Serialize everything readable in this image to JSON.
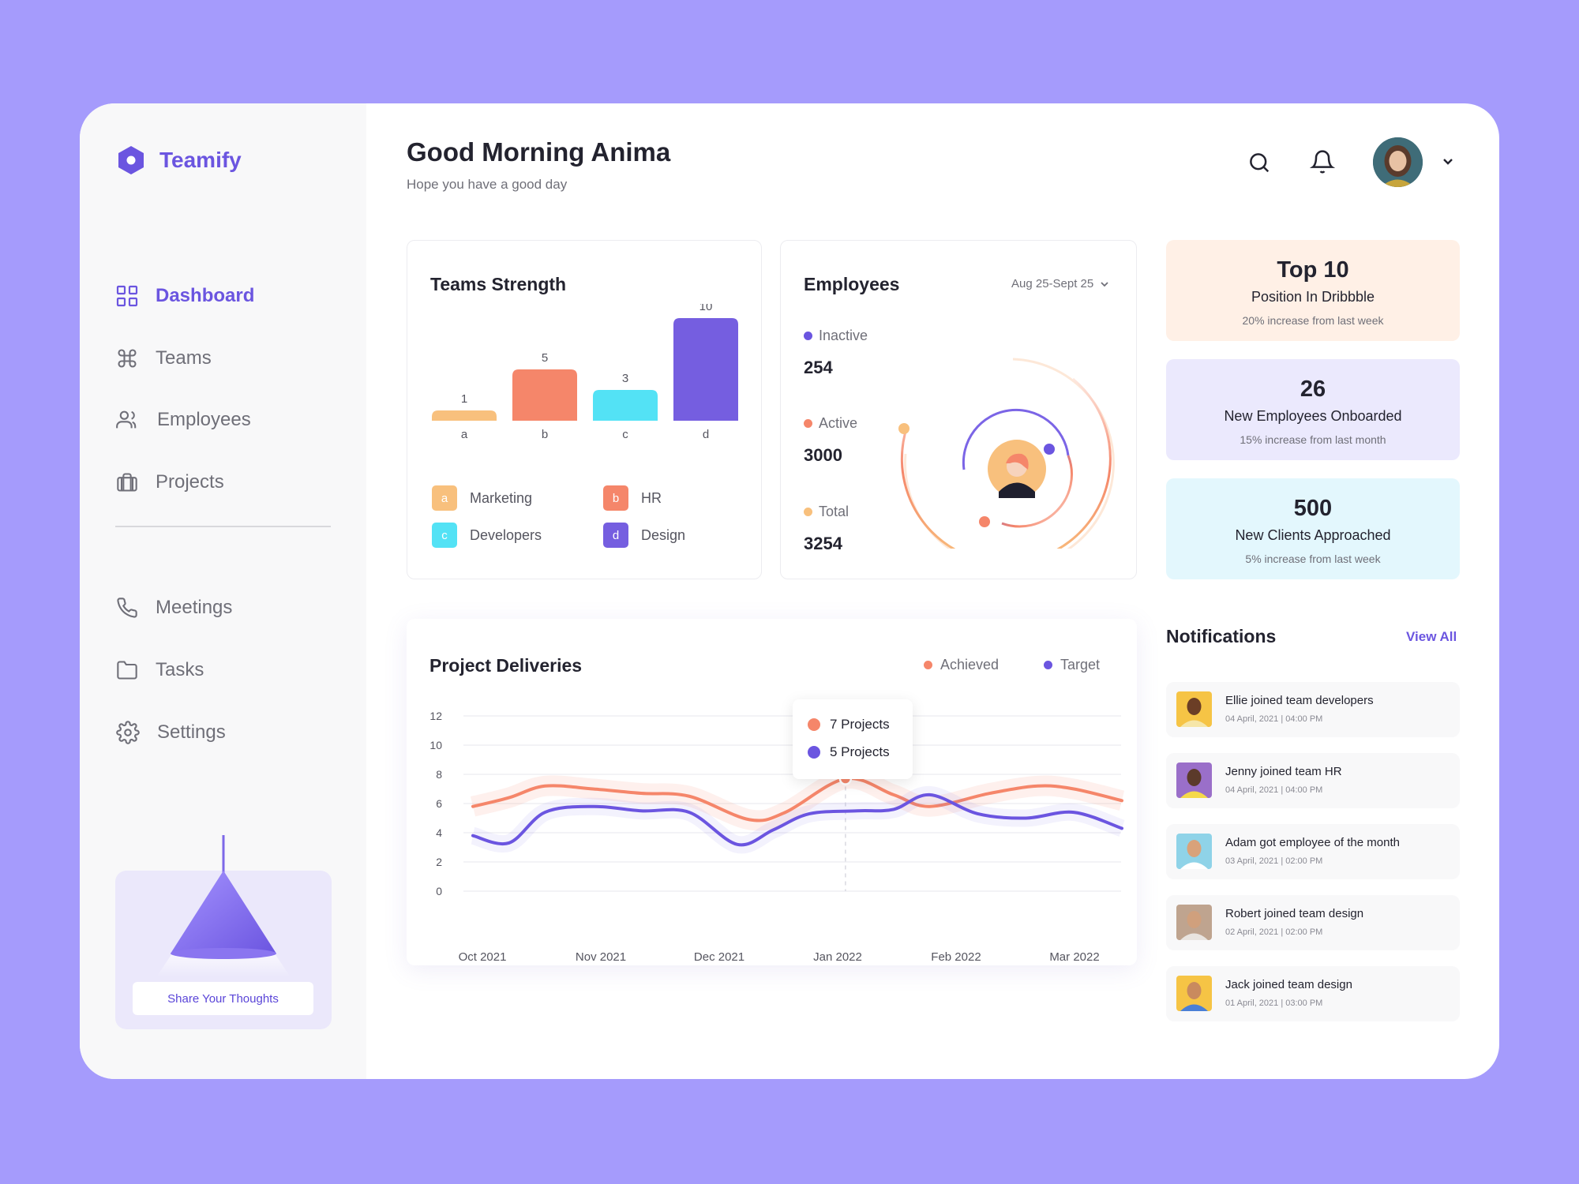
{
  "brand": {
    "name": "Teamify",
    "accent": "#6b55e0"
  },
  "nav_primary": [
    {
      "label": "Dashboard",
      "icon": "grid-icon",
      "active": true
    },
    {
      "label": "Teams",
      "icon": "command-icon"
    },
    {
      "label": "Employees",
      "icon": "users-icon"
    },
    {
      "label": "Projects",
      "icon": "briefcase-icon"
    }
  ],
  "nav_secondary": [
    {
      "label": "Meetings",
      "icon": "phone-icon"
    },
    {
      "label": "Tasks",
      "icon": "folder-icon"
    },
    {
      "label": "Settings",
      "icon": "gear-icon"
    }
  ],
  "promo": {
    "button_label": "Share Your Thoughts"
  },
  "header": {
    "title": "Good Morning Anima",
    "subtitle": "Hope you have a good day"
  },
  "teams_strength": {
    "title": "Teams Strength",
    "legend": [
      {
        "key": "a",
        "label": "Marketing",
        "color": "#f8c07d"
      },
      {
        "key": "b",
        "label": "HR",
        "color": "#f5866a"
      },
      {
        "key": "c",
        "label": "Developers",
        "color": "#53e2f5"
      },
      {
        "key": "d",
        "label": "Design",
        "color": "#755ee0"
      }
    ]
  },
  "employees": {
    "title": "Employees",
    "date_range": "Aug 25-Sept 25",
    "inactive": {
      "label": "Inactive",
      "value": "254",
      "color": "#6b55e0"
    },
    "active": {
      "label": "Active",
      "value": "3000",
      "color": "#f5866a"
    },
    "total": {
      "label": "Total",
      "value": "3254",
      "color": "#f8c07d"
    }
  },
  "stats": [
    {
      "value": "Top 10",
      "title": "Position In Dribbble",
      "sub": "20% increase from last week",
      "bg": "#fff0e6"
    },
    {
      "value": "26",
      "title": "New Employees Onboarded",
      "sub": "15% increase from last month",
      "bg": "#ebe9fd"
    },
    {
      "value": "500",
      "title": "New Clients Approached",
      "sub": "5% increase from last week",
      "bg": "#e3f7fd"
    }
  ],
  "project_deliveries": {
    "title": "Project Deliveries",
    "tooltip": {
      "achieved": "7 Projects",
      "target": "5 Projects"
    }
  },
  "notifications": {
    "title": "Notifications",
    "view_all": "View All",
    "items": [
      {
        "text": "Ellie joined team developers",
        "time": "04 April, 2021 | 04:00 PM",
        "bg": "#f6c445",
        "skin": "#6b3e26",
        "shirt": "#f6e6a8"
      },
      {
        "text": "Jenny joined team HR",
        "time": "04 April, 2021 | 04:00 PM",
        "bg": "#9a6fc9",
        "skin": "#5b3a2a",
        "shirt": "#f5d94a"
      },
      {
        "text": "Adam got employee of the month",
        "time": "03 April, 2021 | 02:00 PM",
        "bg": "#8fd3e8",
        "skin": "#d9a27a",
        "shirt": "#ffffff"
      },
      {
        "text": "Robert joined team design",
        "time": "02 April, 2021 | 02:00 PM",
        "bg": "#bfa48f",
        "skin": "#d0a07d",
        "shirt": "#e9e4df"
      },
      {
        "text": "Jack joined team design",
        "time": "01 April, 2021 | 03:00 PM",
        "bg": "#f6c445",
        "skin": "#c98a5e",
        "shirt": "#4a7fd6"
      }
    ]
  },
  "chart_data": [
    {
      "type": "bar",
      "title": "Teams Strength",
      "categories": [
        "a",
        "b",
        "c",
        "d"
      ],
      "values": [
        1,
        5,
        3,
        10
      ],
      "colors": [
        "#f8c07d",
        "#f5866a",
        "#53e2f5",
        "#755ee0"
      ],
      "ylim": [
        0,
        10
      ]
    },
    {
      "type": "line",
      "title": "Project Deliveries",
      "x_ticks": [
        "Oct 2021",
        "Nov 2021",
        "Dec 2021",
        "Jan 2022",
        "Feb 2022",
        "Mar 2022"
      ],
      "y_ticks": [
        0,
        2,
        4,
        6,
        8,
        10,
        12
      ],
      "ylim": [
        0,
        12
      ],
      "xlim": [
        -0.1,
        5.3
      ],
      "grid": true,
      "legend_position": "top-right",
      "series": [
        {
          "name": "Achieved",
          "color": "#f5866a",
          "x": [
            -0.1,
            0.2,
            0.5,
            0.9,
            1.3,
            1.7,
            2.2,
            2.5,
            3.0,
            3.4,
            3.7,
            4.2,
            4.6,
            4.9,
            5.3
          ],
          "y": [
            5.8,
            6.4,
            7.2,
            7.0,
            6.7,
            6.5,
            4.9,
            5.4,
            7.7,
            6.6,
            5.8,
            6.7,
            7.2,
            7.0,
            6.2
          ]
        },
        {
          "name": "Target",
          "color": "#6b55e0",
          "x": [
            -0.1,
            0.2,
            0.5,
            0.9,
            1.3,
            1.7,
            2.1,
            2.4,
            2.7,
            3.1,
            3.4,
            3.7,
            4.1,
            4.5,
            4.9,
            5.3
          ],
          "y": [
            3.8,
            3.3,
            5.4,
            5.8,
            5.5,
            5.4,
            3.2,
            4.2,
            5.3,
            5.5,
            5.6,
            6.6,
            5.3,
            5.0,
            5.4,
            4.3
          ]
        }
      ]
    },
    {
      "type": "radial",
      "title": "Employees",
      "series": [
        {
          "name": "Inactive",
          "value": 254
        },
        {
          "name": "Active",
          "value": 3000
        },
        {
          "name": "Total",
          "value": 3254
        }
      ]
    }
  ]
}
